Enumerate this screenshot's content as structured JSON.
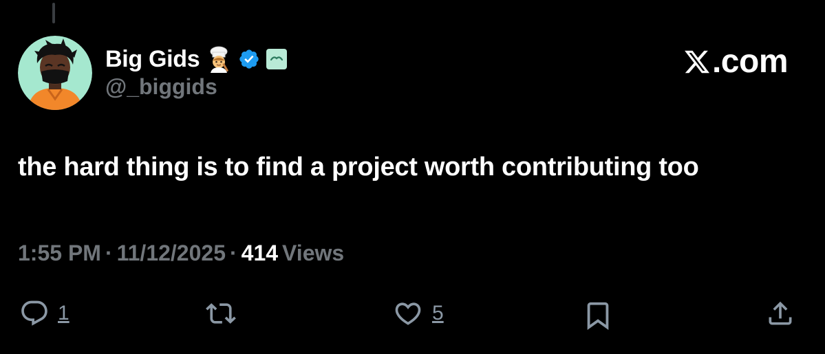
{
  "author": {
    "display_name": "Big Gids",
    "handle": "@_biggids"
  },
  "brand": {
    "label": ".com"
  },
  "post": {
    "text": "the hard thing is to find a project worth contributing too"
  },
  "meta": {
    "time": "1:55 PM",
    "separator": "·",
    "date": "11/12/2025",
    "views_count": "414",
    "views_label": "Views"
  },
  "actions": {
    "reply_count": "1",
    "like_count": "5"
  },
  "colors": {
    "background": "#000000",
    "text_primary": "#ffffff",
    "text_secondary": "#71767b",
    "verified_blue": "#1d9bf0",
    "icon_gray": "#8b98a5"
  },
  "icons": [
    "chef-emoji-icon",
    "verified-badge-icon",
    "affiliate-badge-icon",
    "x-logo-icon",
    "reply-icon",
    "repost-icon",
    "like-icon",
    "bookmark-icon",
    "share-icon"
  ]
}
